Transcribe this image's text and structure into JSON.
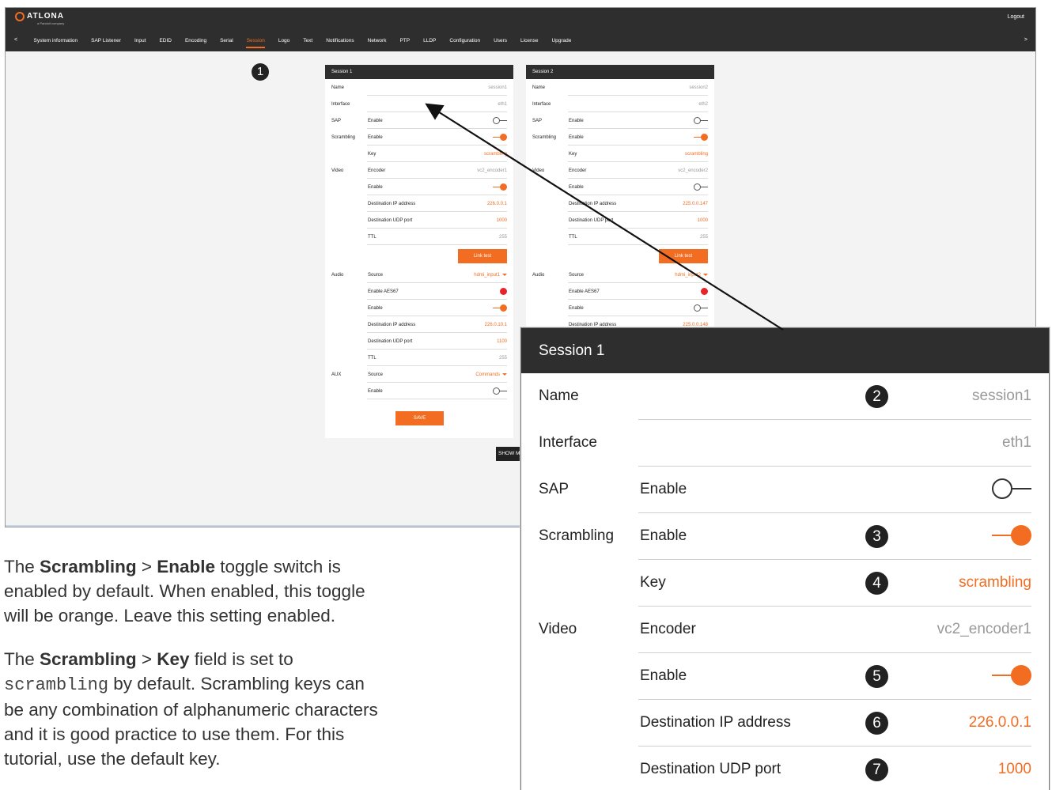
{
  "app": {
    "logo_text": "ATLONA",
    "logo_sub": "a Panduit company",
    "logout": "Logout",
    "nav_prev": "<",
    "nav_next": ">",
    "tabs": [
      {
        "label": "System information"
      },
      {
        "label": "SAP Listener"
      },
      {
        "label": "Input"
      },
      {
        "label": "EDID"
      },
      {
        "label": "Encoding"
      },
      {
        "label": "Serial"
      },
      {
        "label": "Session",
        "active": true
      },
      {
        "label": "Logo"
      },
      {
        "label": "Text"
      },
      {
        "label": "Notifications"
      },
      {
        "label": "Network"
      },
      {
        "label": "PTP"
      },
      {
        "label": "LLDP"
      },
      {
        "label": "Configuration"
      },
      {
        "label": "Users"
      },
      {
        "label": "License"
      },
      {
        "label": "Upgrade"
      }
    ],
    "show_more": "SHOW M"
  },
  "callouts": {
    "c1": "1",
    "c2": "2",
    "c3": "3",
    "c4": "4",
    "c5": "5",
    "c6": "6",
    "c7": "7"
  },
  "session1": {
    "title": "Session 1",
    "name_label": "Name",
    "name": "session1",
    "interface_label": "Interface",
    "interface": "eth1",
    "sap_label": "SAP",
    "sap_enable_label": "Enable",
    "sap_enabled": false,
    "scrambling_label": "Scrambling",
    "scr_enable_label": "Enable",
    "scr_enabled": true,
    "key_label": "Key",
    "key": "scrambling",
    "video_label": "Video",
    "encoder_label": "Encoder",
    "encoder": "vc2_encoder1",
    "video_enable_label": "Enable",
    "video_enabled": true,
    "dst_ip_label": "Destination IP address",
    "dst_ip": "226.0.0.1",
    "dst_udp_label": "Destination UDP port",
    "dst_udp": "1000",
    "ttl_label": "TTL",
    "ttl": "255",
    "link_test": "Link test",
    "audio_label": "Audio",
    "source_label": "Source",
    "audio_source": "hdmi_input1",
    "aes67_label": "Enable AES67",
    "audio_enable_label": "Enable",
    "audio_enabled": true,
    "audio_dst_ip_label": "Destination IP address",
    "audio_dst_ip": "226.0.10.1",
    "audio_dst_udp_label": "Destination UDP port",
    "audio_dst_udp": "1100",
    "audio_ttl_label": "TTL",
    "audio_ttl": "255",
    "aux_label": "AUX",
    "aux_source_label": "Source",
    "aux_source": "Commands",
    "aux_enable_label": "Enable",
    "aux_enabled": false,
    "save": "SAVE"
  },
  "session2": {
    "title": "Session 2",
    "name_label": "Name",
    "name": "session2",
    "interface_label": "Interface",
    "interface": "eth2",
    "sap_label": "SAP",
    "sap_enable_label": "Enable",
    "sap_enabled": false,
    "scrambling_label": "Scrambling",
    "scr_enable_label": "Enable",
    "scr_enabled": true,
    "key_label": "Key",
    "key": "scrambling",
    "video_label": "Video",
    "encoder_label": "Encoder",
    "encoder": "vc2_encoder2",
    "video_enable_label": "Enable",
    "video_enabled": false,
    "dst_ip_label": "Destination IP address",
    "dst_ip": "225.0.0.147",
    "dst_udp_label": "Destination UDP port",
    "dst_udp": "1000",
    "ttl_label": "TTL",
    "ttl": "255",
    "link_test": "Link test",
    "audio_label": "Audio",
    "source_label": "Source",
    "audio_source": "hdmi_input2",
    "aes67_label": "Enable AES67",
    "audio_enable_label": "Enable",
    "audio_enabled": false,
    "audio_dst_ip_label": "Destination IP address",
    "audio_dst_ip": "225.0.0.148"
  },
  "text": {
    "p1_a": "The ",
    "p1_b": "Scrambling",
    "p1_c": " > ",
    "p1_d": "Enable",
    "p1_e": " toggle switch is",
    "p1_l2": "enabled by default. When enabled, this toggle",
    "p1_l3": "will be orange.  Leave this setting enabled.",
    "p2_a": "The ",
    "p2_b": "Scrambling",
    "p2_c": " > ",
    "p2_d": "Key",
    "p2_e": " field is set to",
    "p2_mono": "scrambling",
    "p2_l2b": " by default.  Scrambling keys can",
    "p2_l3": "be any combination of alphanumeric characters",
    "p2_l4": "and it is good practice to use them.  For this",
    "p2_l5": "tutorial, use the default key."
  },
  "colors": {
    "accent": "#f26d21",
    "header": "#2e2e2e",
    "aes_dot": "#e8232a"
  }
}
